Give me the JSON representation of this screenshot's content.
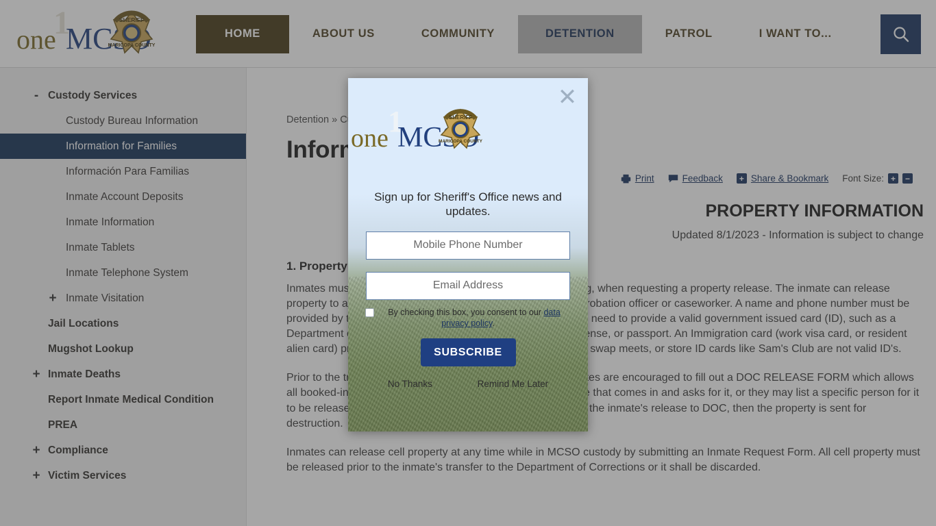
{
  "header": {
    "logo_alt": "oneMCSO Maricopa County Sheriff's Office",
    "nav": [
      {
        "label": "HOME",
        "state": "active-home"
      },
      {
        "label": "ABOUT US",
        "state": "normal"
      },
      {
        "label": "COMMUNITY",
        "state": "normal"
      },
      {
        "label": "DETENTION",
        "state": "current"
      },
      {
        "label": "PATROL",
        "state": "normal"
      },
      {
        "label": "I WANT TO...",
        "state": "normal"
      }
    ],
    "search_icon": "search-icon"
  },
  "sidebar": {
    "items": [
      {
        "label": "Custody Services",
        "level": 1,
        "toggle": "-",
        "active": false
      },
      {
        "label": "Custody Bureau Information",
        "level": 2,
        "toggle": "",
        "active": false
      },
      {
        "label": "Information for Families",
        "level": 2,
        "toggle": "",
        "active": true
      },
      {
        "label": "Información Para Familias",
        "level": 2,
        "toggle": "",
        "active": false
      },
      {
        "label": "Inmate Account Deposits",
        "level": 2,
        "toggle": "",
        "active": false
      },
      {
        "label": "Inmate Information",
        "level": 2,
        "toggle": "",
        "active": false
      },
      {
        "label": "Inmate Tablets",
        "level": 2,
        "toggle": "",
        "active": false
      },
      {
        "label": "Inmate Telephone System",
        "level": 2,
        "toggle": "",
        "active": false
      },
      {
        "label": "Inmate Visitation",
        "level": 2,
        "toggle": "+",
        "active": false
      },
      {
        "label": "Jail Locations",
        "level": 1,
        "toggle": "",
        "active": false
      },
      {
        "label": "Mugshot Lookup",
        "level": 1,
        "toggle": "",
        "active": false
      },
      {
        "label": "Inmate Deaths",
        "level": 1,
        "toggle": "+",
        "active": false
      },
      {
        "label": "Report Inmate Medical Condition",
        "level": 1,
        "toggle": "",
        "active": false
      },
      {
        "label": "PREA",
        "level": 1,
        "toggle": "",
        "active": false
      },
      {
        "label": "Compliance",
        "level": 1,
        "toggle": "+",
        "active": false
      },
      {
        "label": "Victim Services",
        "level": 1,
        "toggle": "+",
        "active": false
      }
    ]
  },
  "main": {
    "breadcrumb": "Detention » Custody Services » Information for Families",
    "title": "Information for Families",
    "tools": {
      "print": "Print",
      "feedback": "Feedback",
      "share": "Share & Bookmark",
      "share_icon_glyph": "+",
      "font_size_label": "Font Size:",
      "font_increase": "+",
      "font_decrease": "−"
    },
    "section_heading": "PROPERTY INFORMATION",
    "section_note": "Updated 8/1/2023 - Information is subject to change",
    "subheading_1": "1. Property Release",
    "paragraphs": [
      "Inmates must release all their property, except for their clothing, when requesting a property release. The inmate can release property to anyone, including their attorney, public defender, probation officer or caseworker. A name and phone number must be provided by the inmate.The person picking up the property will need to provide a valid government issued card (ID), such as a Department of Motor Vehicles (DMV) identification, driver's license, or passport. An Immigration card (work visa card, or resident alien card) presented with a valid passport is accepted. ID's at swap meets, or store ID cards like Sam's Club are not valid ID's.",
      "Prior to the transfer to DOC (Department of Corrections) inmates are encouraged to fill out a DOC RELEASE FORM which allows all booked-in personal property items to be released to anyone that comes in and asks for it, or they may list a specific person for it to be released to. If their items are not picked up in 30 days of the inmate's release to DOC, then the property is sent for destruction.",
      "Inmates can release cell property at any time while in MCSO custody by submitting an Inmate Request Form. All cell property must be released prior to the inmate's transfer to the Department of Corrections or it shall be discarded."
    ]
  },
  "modal": {
    "close_icon": "close-icon",
    "logo_alt": "oneMCSO Maricopa County Sheriff's Office",
    "message": "Sign up for Sheriff's Office news and updates.",
    "phone_placeholder": "Mobile Phone Number",
    "phone_value": "",
    "email_placeholder": "Email Address",
    "email_value": "",
    "consent_text_before": "By checking this box, you consent to our ",
    "consent_link": "data privacy policy",
    "consent_text_after": ".",
    "consent_checked": false,
    "subscribe_label": "SUBSCRIBE",
    "no_thanks_label": "No Thanks",
    "remind_label": "Remind Me Later"
  },
  "colors": {
    "nav_home_bg": "#463a17",
    "nav_detention_bg": "#787878",
    "search_bg": "#1b3461",
    "sidebar_active_bg": "#163258",
    "subscribe_bg": "#1f3f82",
    "link_blue": "#1b3461"
  }
}
